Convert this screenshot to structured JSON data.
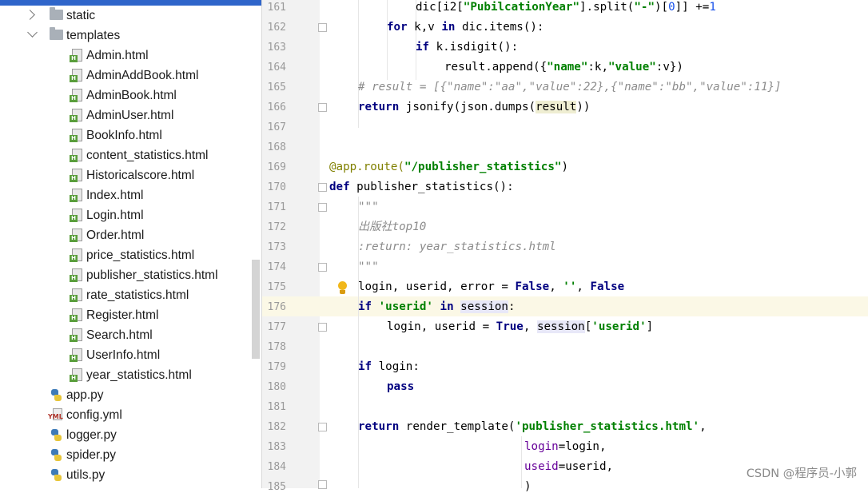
{
  "project_tree": {
    "items": [
      {
        "label": "static",
        "kind": "folder",
        "arrow": "right",
        "level": 1
      },
      {
        "label": "templates",
        "kind": "folder",
        "arrow": "down",
        "level": 1
      },
      {
        "label": "Admin.html",
        "kind": "html",
        "level": 2
      },
      {
        "label": "AdminAddBook.html",
        "kind": "html",
        "level": 2
      },
      {
        "label": "AdminBook.html",
        "kind": "html",
        "level": 2
      },
      {
        "label": "AdminUser.html",
        "kind": "html",
        "level": 2
      },
      {
        "label": "BookInfo.html",
        "kind": "html",
        "level": 2
      },
      {
        "label": "content_statistics.html",
        "kind": "html",
        "level": 2
      },
      {
        "label": "Historicalscore.html",
        "kind": "html",
        "level": 2
      },
      {
        "label": "Index.html",
        "kind": "html",
        "level": 2
      },
      {
        "label": "Login.html",
        "kind": "html",
        "level": 2
      },
      {
        "label": "Order.html",
        "kind": "html",
        "level": 2
      },
      {
        "label": "price_statistics.html",
        "kind": "html",
        "level": 2
      },
      {
        "label": "publisher_statistics.html",
        "kind": "html",
        "level": 2
      },
      {
        "label": "rate_statistics.html",
        "kind": "html",
        "level": 2
      },
      {
        "label": "Register.html",
        "kind": "html",
        "level": 2
      },
      {
        "label": "Search.html",
        "kind": "html",
        "level": 2
      },
      {
        "label": "UserInfo.html",
        "kind": "html",
        "level": 2
      },
      {
        "label": "year_statistics.html",
        "kind": "html",
        "level": 2
      },
      {
        "label": "app.py",
        "kind": "python",
        "level": 1
      },
      {
        "label": "config.yml",
        "kind": "yaml",
        "level": 1
      },
      {
        "label": "logger.py",
        "kind": "python",
        "level": 1
      },
      {
        "label": "spider.py",
        "kind": "python",
        "level": 1
      },
      {
        "label": "utils.py",
        "kind": "python",
        "level": 1
      }
    ],
    "icons": {
      "folder": "folder-icon",
      "html": "html-file-icon",
      "python": "python-file-icon",
      "yaml": "yaml-file-icon"
    }
  },
  "editor": {
    "line_numbers": [
      "161",
      "162",
      "163",
      "164",
      "165",
      "166",
      "167",
      "168",
      "169",
      "170",
      "171",
      "172",
      "173",
      "174",
      "175",
      "176",
      "177",
      "178",
      "179",
      "180",
      "181",
      "182",
      "183",
      "184",
      "185"
    ],
    "current_line": "176",
    "intention_icon": "lightbulb-icon",
    "code": {
      "l161_a": "dic[i2[",
      "l161_b": "\"PubilcationYear\"",
      "l161_c": "].split(",
      "l161_d": "\"-\"",
      "l161_e": ")[",
      "l161_f": "0",
      "l161_g": "]] +=",
      "l161_h": "1",
      "l162_kw1": "for",
      "l162_a": " k,v ",
      "l162_kw2": "in",
      "l162_b": " dic.items():",
      "l163_kw": "if",
      "l163_a": " k.isdigit():",
      "l164_a": "result.append({",
      "l164_b": "\"name\"",
      "l164_c": ":k,",
      "l164_d": "\"value\"",
      "l164_e": ":v})",
      "l165": "# result = [{\"name\":\"aa\",\"value\":22},{\"name\":\"bb\",\"value\":11}]",
      "l166_kw": "return",
      "l166_a": " jsonify(json.dumps(",
      "l166_b": "result",
      "l166_c": "))",
      "l169_a": "@app.route(",
      "l169_b": "\"/publisher_statistics\"",
      "l169_c": ")",
      "l170_kw": "def",
      "l170_a": " publisher_statistics():",
      "l171": "\"\"\"",
      "l172": "出版社top10",
      "l173": ":return: year_statistics.html",
      "l174": "\"\"\"",
      "l175_a": "login, userid, error = ",
      "l175_b": "False",
      "l175_c": ", ",
      "l175_d": "''",
      "l175_e": ", ",
      "l175_f": "False",
      "l176_kw1": "if",
      "l176_a": " ",
      "l176_b": "'userid'",
      "l176_c": " ",
      "l176_kw2": "in",
      "l176_d": " ",
      "l176_e": "session",
      "l176_f": ":",
      "l177_a": "login, userid = ",
      "l177_b": "True",
      "l177_c": ", ",
      "l177_d": "session",
      "l177_e": "[",
      "l177_f": "'userid'",
      "l177_g": "]",
      "l179_kw": "if",
      "l179_a": " login:",
      "l180_kw": "pass",
      "l182_kw": "return",
      "l182_a": " render_template(",
      "l182_b": "'publisher_statistics.html'",
      "l182_c": ",",
      "l183_a": "login",
      "l183_b": "=login,",
      "l184_a": "useid",
      "l184_b": "=userid,",
      "l185": ")"
    }
  },
  "watermark": "CSDN @程序员-小郭",
  "colors": {
    "keyword": "#000080",
    "string": "#008000",
    "comment": "#8c8c8c",
    "number": "#1750eb",
    "decorator": "#808000",
    "current_line": "#fbf8e6"
  }
}
